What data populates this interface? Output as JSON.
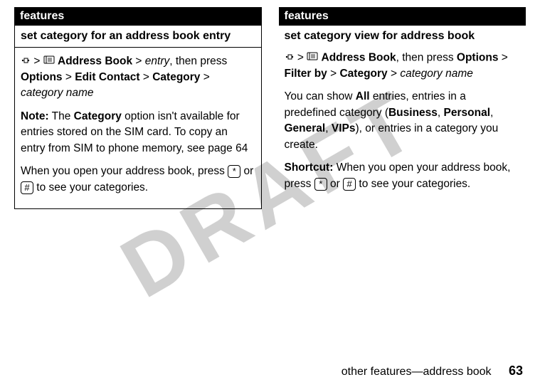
{
  "watermark": "DRAFT",
  "left": {
    "header": "features",
    "title": "set category for an address book entry",
    "nav_path": {
      "item1": "Address Book",
      "sep": ">",
      "entry": "entry",
      "then_press": ", then press",
      "options": "Options",
      "edit_contact": "Edit Contact",
      "category": "Category",
      "category_name": "category name"
    },
    "note_label": "Note:",
    "note_text_before": " The ",
    "note_category_word": "Category",
    "note_text_after": " option isn't available for entries stored on the SIM card. To copy an entry from SIM to phone memory, see page 64",
    "para2_before": "When you open your address book, press ",
    "para2_mid": " or ",
    "para2_after": " to see your categories.",
    "key_star": "*",
    "key_hash": "#"
  },
  "right": {
    "header": "features",
    "title": "set category view for address book",
    "nav_path": {
      "item1": "Address Book",
      "then_press": ", then press",
      "options": "Options",
      "sep": ">",
      "filter_by": "Filter by",
      "category": "Category",
      "category_name": "category name"
    },
    "para1_before": "You can show ",
    "all_word": "All",
    "para1_mid1": " entries, entries in a predefined category (",
    "biz": "Business",
    "comma1": ", ",
    "personal": "Personal",
    "comma2": ", ",
    "general": "General",
    "comma3": ", ",
    "vips": "VIPs",
    "para1_after": "), or entries in a category you create.",
    "shortcut_label": "Shortcut:",
    "shortcut_before": " When you open your address book, press ",
    "shortcut_mid": " or ",
    "shortcut_after": " to see your categories.",
    "key_star": "*",
    "key_hash": "#"
  },
  "footer": {
    "text": "other features—address book",
    "page": "63"
  }
}
